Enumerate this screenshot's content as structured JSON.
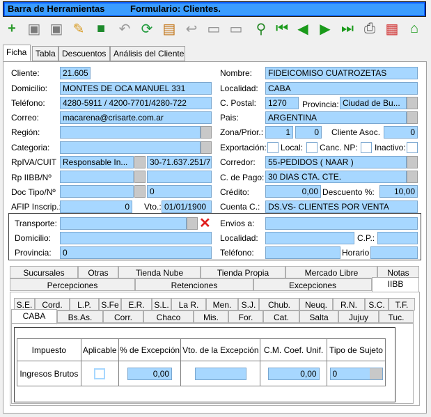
{
  "window": {
    "app_name": "Barra de Herramientas",
    "form_title": "Formulario: Clientes."
  },
  "toolbar": {
    "icons": [
      "add-icon",
      "save-icon",
      "save-as-icon",
      "edit-icon",
      "delete-icon",
      "undo-icon",
      "refresh-icon",
      "film-icon",
      "back-arrow-icon",
      "disabled-1-icon",
      "disabled-2-icon",
      "search-icon",
      "first-record-icon",
      "previous-record-icon",
      "next-record-icon",
      "last-record-icon",
      "print-icon",
      "gift-icon",
      "home-icon"
    ]
  },
  "main_tabs": [
    "Ficha",
    "Tabla",
    "Descuentos",
    "Análisis del Cliente"
  ],
  "form": {
    "cliente_label": "Cliente:",
    "cliente": "21.605",
    "nombre_label": "Nombre:",
    "nombre": "FIDEICOMISO CUATROZETAS",
    "domicilio_label": "Domicilio:",
    "domicilio": "MONTES DE OCA MANUEL 331",
    "localidad_label": "Localidad:",
    "localidad": "CABA",
    "telefono_label": "Teléfono:",
    "telefono": "4280-5911 / 4200-7701/4280-722",
    "cpostal_label": "C. Postal:",
    "cpostal": "1270",
    "provincia_label": "Provincia:",
    "provincia": "Ciudad de Bu...",
    "correo_label": "Correo:",
    "correo": "macarena@crisarte.com.ar",
    "pais_label": "Pais:",
    "pais": "ARGENTINA",
    "region_label": "Región:",
    "region": "",
    "zona_label": "Zona/Prior.:",
    "zona": "1",
    "prior": "0",
    "cliente_asoc_label": "Cliente Asoc.",
    "cliente_asoc": "0",
    "categoria_label": "Categoria:",
    "categoria": "",
    "exportacion_label": "Exportación:",
    "local_label": "Local:",
    "canc_label": "Canc. NP:",
    "inactivo_label": "Inactivo:",
    "rpiva_label": "RpIVA/CUIT",
    "rpiva": "Responsable In...",
    "cuit": "30-71.637.251/7",
    "corredor_label": "Corredor:",
    "corredor": "55-PEDIDOS ( NAAR )",
    "rpiibb_label": "Rp IIBB/Nº",
    "rpiibb": "",
    "cpago_label": "C. de Pago:",
    "cpago": "30 DIAS CTA. CTE.",
    "doctipo_label": "Doc Tipo/Nº",
    "doctipo": "",
    "docnum": "0",
    "credito_label": "Crédito:",
    "credito": "0,00",
    "descuento_label": "Descuento %:",
    "descuento": "10,00",
    "afip_label": "AFIP Inscrip.:",
    "afip": "0",
    "vto_label": "Vto.:",
    "vto": "01/01/1900",
    "cuentac_label": "Cuenta C.:",
    "cuentac": "DS.VS- CLIENTES POR VENTA"
  },
  "envio": {
    "transporte_label": "Transporte:",
    "transporte": "",
    "envios_label": "Envios a:",
    "envios": "",
    "domicilio_label": "Domicilio:",
    "domicilio": "",
    "localidad_label": "Localidad:",
    "localidad": "",
    "cp_label": "C.P.:",
    "cp": "",
    "provincia_label": "Provincia:",
    "provincia": "0",
    "telefono_label": "Teléfono:",
    "telefono": "",
    "horario_label": "Horario",
    "horario": ""
  },
  "sub_tabs_row1": [
    "Sucursales",
    "Otras",
    "Tienda Nube",
    "Tienda Propia",
    "Mercado Libre",
    "Notas"
  ],
  "sub_tabs_row2": [
    "Percepciones",
    "Retenciones",
    "Excepciones",
    "IIBB"
  ],
  "province_tabs_row1": [
    "S.E.",
    "Cord.",
    "L.P.",
    "S.Fe",
    "E.R.",
    "S.L.",
    "La R.",
    "Men.",
    "S.J.",
    "Chub.",
    "Neuq.",
    "R.N.",
    "S.C.",
    "T.F."
  ],
  "province_tabs_row2": [
    "CABA",
    "Bs.As.",
    "Corr.",
    "Chaco",
    "Mis.",
    "For.",
    "Cat.",
    "Salta",
    "Jujuy",
    "Tuc."
  ],
  "iibb_table": {
    "headers": [
      "Impuesto",
      "Aplicable",
      "% de Excepción",
      "Vto. de la Excepción",
      "C.M. Coef. Unif.",
      "Tipo de Sujeto"
    ],
    "row": {
      "impuesto": "Ingresos Brutos",
      "excepcion": "0,00",
      "vto": "",
      "coef": "0,00",
      "tipo": "0"
    }
  }
}
